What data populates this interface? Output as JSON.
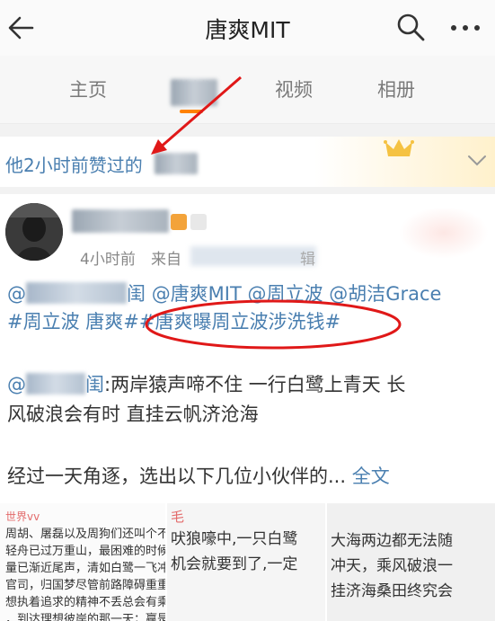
{
  "header": {
    "title": "唐爽MIT",
    "back_icon": "back-arrow-icon",
    "search_icon": "search-icon",
    "more_icon": "more-icon"
  },
  "tabs": [
    {
      "label": "主页"
    },
    {
      "label": "微博"
    },
    {
      "label": "视频"
    },
    {
      "label": "相册"
    }
  ],
  "liked_banner": {
    "text": "他2小时前赞过的",
    "crown_icon": "crown-icon",
    "chevron_icon": "chevron-down-icon"
  },
  "post": {
    "time": "4小时前",
    "from_label": "来自",
    "source_suffix": "辑",
    "line1": {
      "mention_prefix": "@",
      "suffix": "闺",
      "m2": "@唐爽MIT",
      "m3": "@周立波",
      "m4": "@胡洁Grace"
    },
    "line2": {
      "topic1": "#周立波 唐爽#",
      "topic2": "#唐爽曝周立波涉洗钱#"
    },
    "quote_prefix": "@",
    "quote_mid": "闺",
    "quote_text": ":两岸猿声啼不住 一行白鹭上青天 长",
    "quote_text2": "风破浪会有时 直挂云帆济沧海",
    "summary": "经过一天角逐，选出以下几位小伙伴的...",
    "full_text": "全文"
  },
  "thumbs": {
    "t1_head": "世界vv",
    "t1_lines": [
      "周胡、屠磊以及周狗们还叫个不休",
      "轻舟已过万重山，最困难的时候已",
      "量已渐近尾声，清如白鹭一飞冲天",
      "官司，归国梦尽管前路障碍重重，",
      "想执着追求的精神不丢总会有乘风",
      "，到达理想彼岸的那一天；赢是一"
    ],
    "t2_head": "毛",
    "t2_lines": [
      "吠狼嚎中,一只白鹭",
      "机会就要到了,一定",
      ""
    ],
    "t3_lines": [
      "大海两边都无法随",
      "冲天，乘风破浪一",
      "挂济海桑田终究会"
    ]
  }
}
